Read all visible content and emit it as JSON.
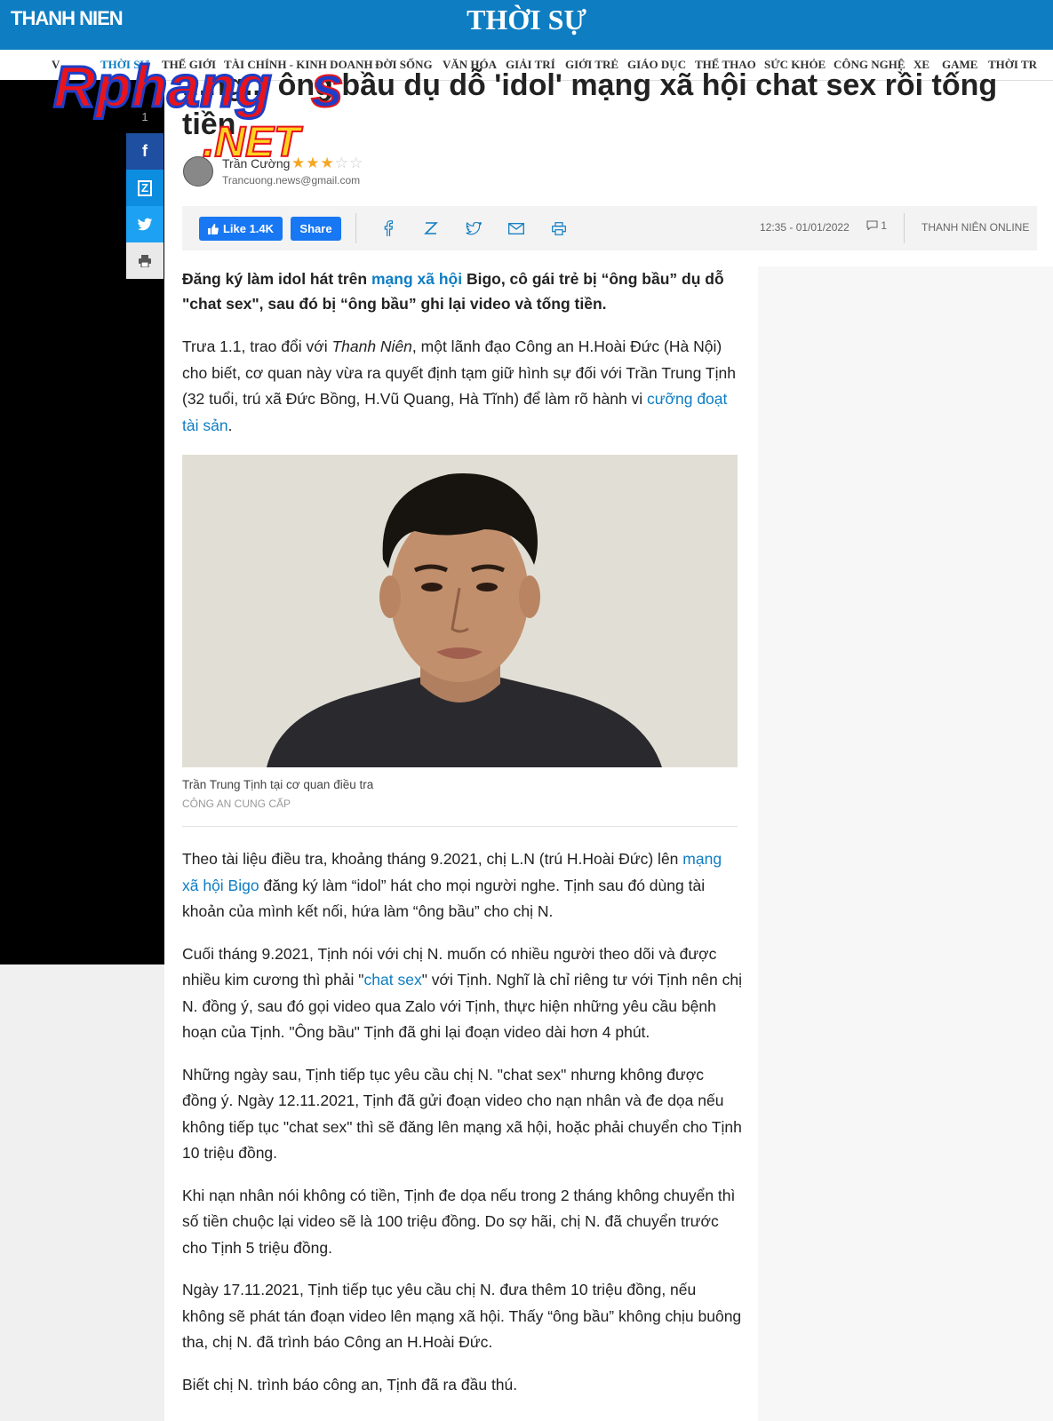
{
  "header": {
    "logo": "THANH NIEN",
    "section": "THỜI SỰ"
  },
  "nav": [
    {
      "label": "V"
    },
    {
      "label": "THỜI SỰ"
    },
    {
      "label": "THẾ GIỚI"
    },
    {
      "label": "TÀI CHÍNH - KINH DOANH"
    },
    {
      "label": "ĐỜI SỐNG"
    },
    {
      "label": "VĂN HÓA"
    },
    {
      "label": "GIẢI TRÍ"
    },
    {
      "label": "GIỚI TRẺ"
    },
    {
      "label": "GIÁO DỤC"
    },
    {
      "label": "THỂ THAO"
    },
    {
      "label": "SỨC KHỎE"
    },
    {
      "label": "CÔNG NGHỆ"
    },
    {
      "label": "XE"
    },
    {
      "label": "GAME"
    },
    {
      "label": "THỜI TR"
    }
  ],
  "watermark": {
    "text1": "Rphang",
    "text2": "s",
    "text3": ".NET"
  },
  "share_rail": {
    "count": "1",
    "facebook_icon": "f",
    "zalo_icon": "Z",
    "twitter_icon": "twitter-icon",
    "print_icon": "print-icon"
  },
  "article": {
    "headline_line1": "...ng... ông bầu dụ dỗ 'idol' mạng xã hội chat sex rồi tống",
    "headline_line2": "tiền",
    "author": "Trần Cường",
    "email": "Trancuong.news@gmail.com",
    "rating": {
      "filled": 3,
      "total": 5
    },
    "like_label": "Like 1.4K",
    "share_label": "Share",
    "datetime": "12:35 - 01/01/2022",
    "comment_count": "1",
    "source": "THANH NIÊN ONLINE",
    "lead_a": "Đăng ký làm idol hát trên ",
    "lead_link": "mạng xã hội",
    "lead_b": " Bigo, cô gái trẻ bị “ông bầu” dụ dỗ \"chat sex\", sau đó bị “ông bầu” ghi lại video và tống tiền.",
    "p1_a": "Trưa 1.1, trao đổi với ",
    "p1_italic": "Thanh Niên",
    "p1_b": ", một lãnh đạo Công an H.Hoài Đức (Hà Nội) cho biết, cơ quan này vừa ra quyết định tạm giữ hình sự đối với Trần Trung Tịnh (32 tuổi, trú xã Đức Bồng, H.Vũ Quang, Hà Tĩnh) để làm rõ hành vi ",
    "p1_link": "cưỡng đoạt tài sản",
    "p1_c": ".",
    "photo_caption": "Trần Trung Tịnh tại cơ quan điều tra",
    "photo_credit": "CÔNG AN CUNG CẤP",
    "p2_a": "Theo tài liệu điều tra, khoảng tháng 9.2021, chị L.N (trú H.Hoài Đức) lên ",
    "p2_link": "mạng xã hội Bigo",
    "p2_b": " đăng ký làm “idol” hát cho mọi người nghe. Tịnh sau đó dùng tài khoản của mình kết nối, hứa làm “ông bầu” cho chị N.",
    "p3_a": "Cuối tháng 9.2021, Tịnh nói với chị N. muốn có nhiều người theo dõi và được nhiều kim cương thì phải \"",
    "p3_link": "chat sex",
    "p3_b": "\" với Tịnh. Nghĩ là chỉ riêng tư với Tịnh nên chị N. đồng ý, sau đó gọi video qua Zalo với Tịnh, thực hiện những yêu cầu bệnh hoạn của Tịnh. \"Ông bầu\" Tịnh đã ghi lại đoạn video dài hơn 4 phút.",
    "p4": "Những ngày sau, Tịnh tiếp tục yêu cầu chị N. \"chat sex\" nhưng không được đồng ý. Ngày 12.11.2021, Tịnh đã gửi đoạn video cho nạn nhân và đe dọa nếu không tiếp tục \"chat sex\" thì sẽ đăng lên mạng xã hội, hoặc phải chuyển cho Tịnh 10 triệu đồng.",
    "p5": "Khi nạn nhân nói không có tiền, Tịnh đe dọa nếu trong 2 tháng không chuyển thì số tiền chuộc lại video sẽ là 100 triệu đồng. Do sợ hãi, chị N. đã chuyển trước cho Tịnh 5 triệu đồng.",
    "p6": "Ngày 17.11.2021, Tịnh tiếp tục yêu cầu chị N. đưa thêm 10 triệu đồng, nếu không sẽ phát tán đoạn video lên mạng xã hội. Thấy “ông bầu” không chịu buông tha, chị N. đã trình báo Công an H.Hoài Đức.",
    "p7": "Biết chị N. trình báo công an, Tịnh đã ra đầu thú."
  },
  "colors": {
    "brand": "#0e7dc2",
    "facebook": "#1877f2",
    "watermark_red": "#e8141c",
    "watermark_blue": "#1e3ec8",
    "watermark_yellow": "#ffd21f"
  }
}
